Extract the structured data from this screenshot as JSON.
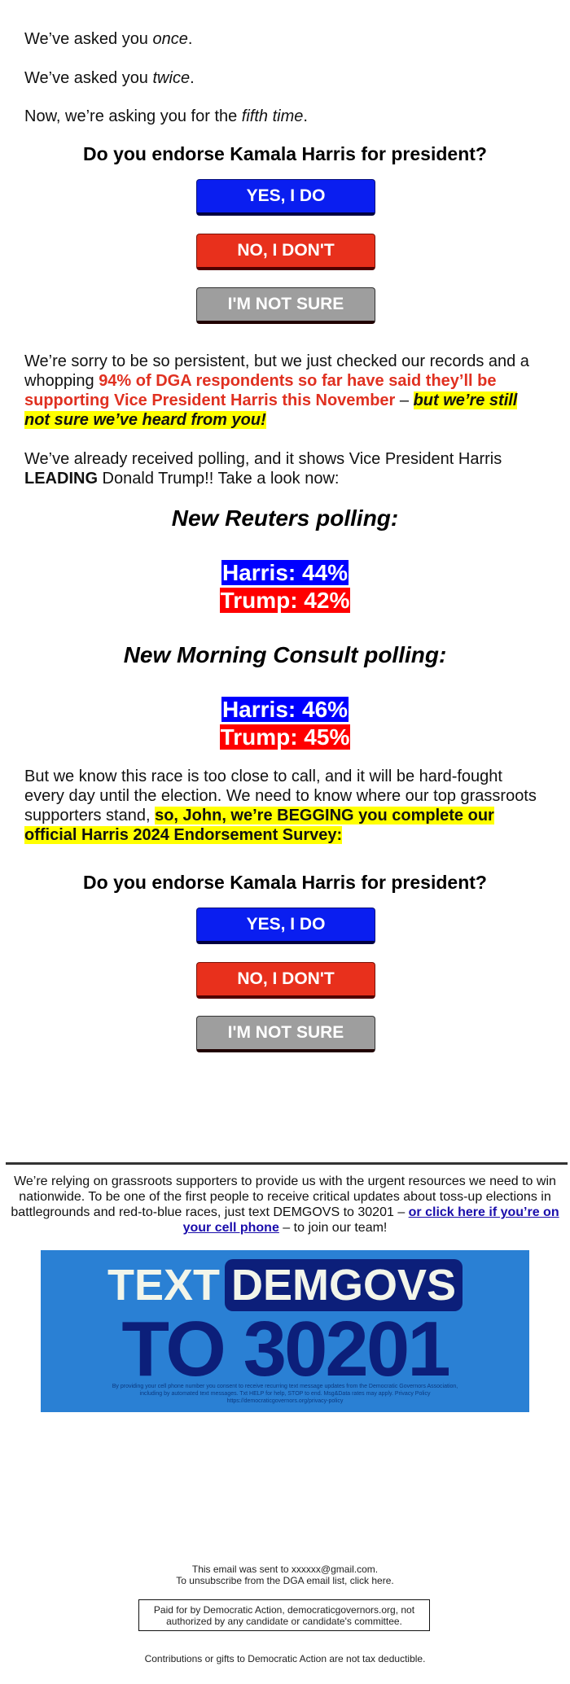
{
  "intro": {
    "line1_prefix": "We’ve asked you ",
    "line1_em": "once",
    "line1_suffix": ".",
    "line2_prefix": "We’ve asked you ",
    "line2_em": "twice",
    "line2_suffix": ".",
    "line3_prefix": "Now, we’re asking you for the ",
    "line3_em": "fifth time",
    "line3_suffix": "."
  },
  "survey1": {
    "question": "Do you endorse Kamala Harris for president?",
    "buttons": [
      {
        "label": "YES, I DO",
        "color": "#0a1ef0"
      },
      {
        "label": "NO, I DON'T",
        "color": "#e8301c"
      },
      {
        "label": "I'M NOT SURE",
        "color": "#9e9e9e"
      }
    ]
  },
  "persistent": {
    "prefix": "We’re sorry to be so persistent, but we just checked our records and a whopping ",
    "red": "94% of DGA respondents so far have said they’ll be supporting Vice President Harris this November",
    "dash": " – ",
    "highlight": "but we’re still not sure we’ve heard from you!"
  },
  "polling_intro": {
    "prefix": "We’ve already received polling, and it shows Vice President Harris ",
    "bold": "LEADING",
    "suffix": " Donald Trump!! Take a look now:"
  },
  "polls": [
    {
      "title": "New Reuters polling:",
      "harris": "Harris: 44%",
      "trump": "Trump: 42%"
    },
    {
      "title": "New Morning Consult polling:",
      "harris": "Harris: 46%",
      "trump": "Trump: 45%"
    }
  ],
  "race": {
    "prefix": "But we know this race is too close to call, and it will be hard-fought every day until the election. We need to know where our top grassroots supporters stand, ",
    "highlight": "so, John,  we’re BEGGING you complete our official Harris 2024 Endorsement Survey:"
  },
  "survey2": {
    "question": "Do you endorse Kamala Harris for president?",
    "buttons": [
      {
        "label": "YES, I DO"
      },
      {
        "label": "NO, I DON'T"
      },
      {
        "label": "I'M NOT SURE"
      }
    ]
  },
  "grassroots": {
    "text": "We’re relying on grassroots supporters to provide us with the urgent resources we need to win nationwide. To be one of the first people to receive critical updates about toss-up elections in battlegrounds and red-to-blue races, just text DEMGOVS to 30201 – ",
    "link": "or click here if you’re on your cell phone",
    "suffix": " – to join our team!"
  },
  "banner": {
    "text_word": "TEXT",
    "keyword": "DEMGOVS",
    "to_line": "TO 30201",
    "fine_print": "By providing your cell phone number you consent to receive recurring text message updates from the Democratic Governors Association, including by automated text messages. Txt HELP for help, STOP to end. Msg&Data rates may apply. Privacy Policy https://democraticgovernors.org/privacy-policy",
    "bg_color": "#2a80d4",
    "navy_color": "#0c1f7a"
  },
  "footer": {
    "sent_to": "This email was sent to xxxxxx@gmail.com.",
    "unsubscribe": "To unsubscribe from the DGA email list, click here.",
    "paid_for": "Paid for by Democratic Action, democraticgovernors.org, not authorized by any candidate or candidate's committee.",
    "tax": "Contributions or gifts to Democratic Action are not tax deductible."
  }
}
